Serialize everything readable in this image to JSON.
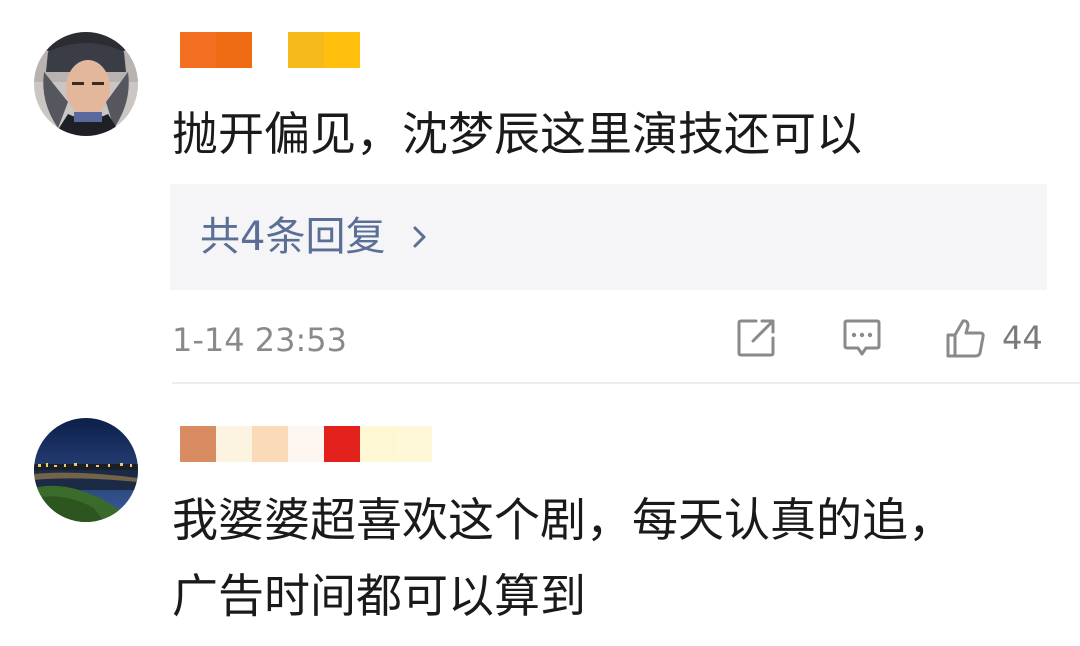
{
  "comments": [
    {
      "avatar": "avatar-helmet-person",
      "username_redacted_colors": [
        "#f37023",
        "#fbba12"
      ],
      "text": "抛开偏见，沈梦辰这里演技还可以",
      "replies_label": "共4条回复",
      "timestamp": "1-14 23:53",
      "like_count": "44",
      "icons": [
        "share-icon",
        "comment-icon",
        "like-icon",
        "chevron-right-icon"
      ]
    },
    {
      "avatar": "avatar-night-river",
      "username_redacted_colors": [
        "#d98c62",
        "#fdf3e1",
        "#fbdbb7",
        "#fef7f1",
        "#e2211c",
        "#fdf7d3"
      ],
      "text": "我婆婆超喜欢这个剧，每天认真的追，\n广告时间都可以算到"
    }
  ]
}
